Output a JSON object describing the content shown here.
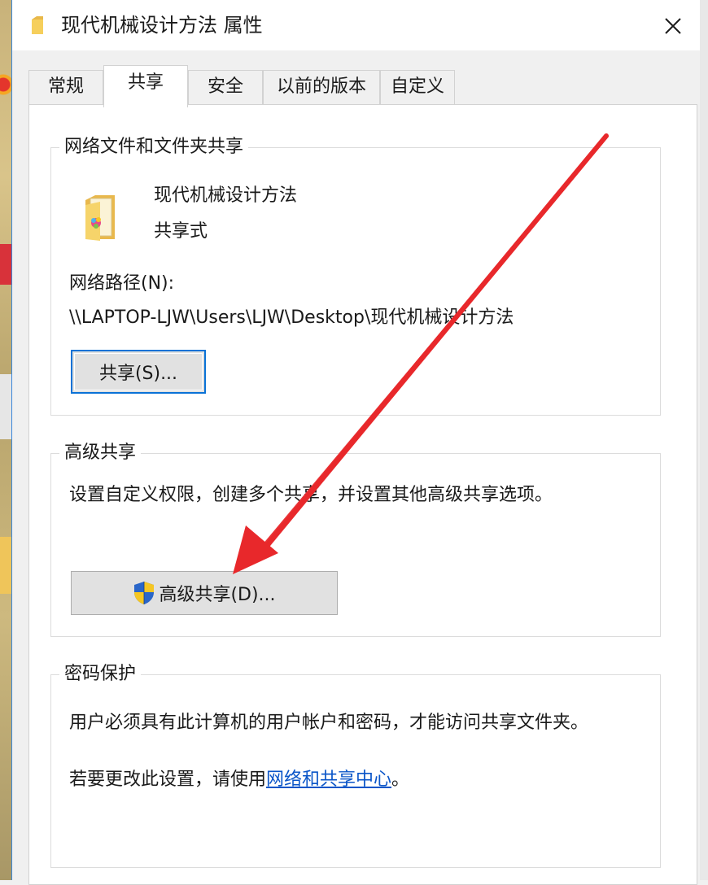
{
  "window": {
    "title": "现代机械设计方法 属性"
  },
  "tabs": [
    {
      "label": "常规",
      "active": false
    },
    {
      "label": "共享",
      "active": true
    },
    {
      "label": "安全",
      "active": false
    },
    {
      "label": "以前的版本",
      "active": false
    },
    {
      "label": "自定义",
      "active": false
    }
  ],
  "network_sharing": {
    "title": "网络文件和文件夹共享",
    "folder_name": "现代机械设计方法",
    "share_status": "共享式",
    "path_label": "网络路径(N):",
    "path_value": "\\\\LAPTOP-LJW\\Users\\LJW\\Desktop\\现代机械设计方法",
    "share_button": "共享(S)..."
  },
  "advanced_sharing": {
    "title": "高级共享",
    "description": "设置自定义权限，创建多个共享，并设置其他高级共享选项。",
    "button": "高级共享(D)..."
  },
  "password_protection": {
    "title": "密码保护",
    "description": "用户必须具有此计算机的用户帐户和密码，才能访问共享文件夹。",
    "change_prefix": "若要更改此设置，请使用",
    "change_link": "网络和共享中心",
    "change_suffix": "。"
  },
  "colors": {
    "accent": "#0a72d6",
    "link": "#0a55c8",
    "annotation_arrow": "#e8282b"
  },
  "icons": {
    "title": "folder-icon",
    "close": "close-icon",
    "folder": "shared-folder-icon",
    "shield": "uac-shield-icon"
  }
}
